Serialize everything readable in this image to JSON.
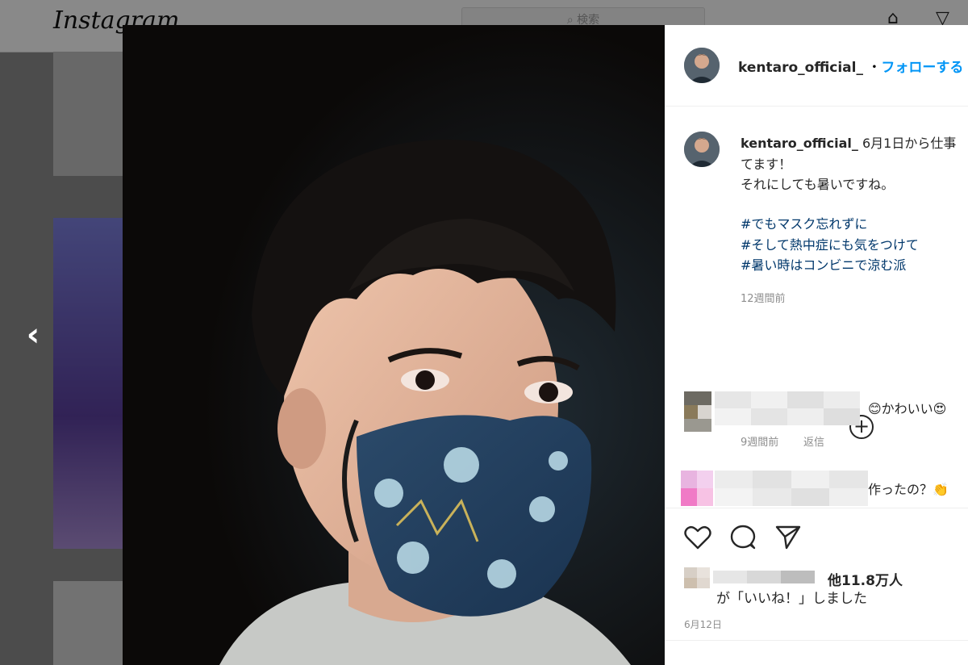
{
  "background": {
    "logo": "Instagram",
    "search_placeholder": "検索"
  },
  "modal": {
    "header": {
      "username": "kentaro_official_",
      "separator": "・",
      "follow_label": "フォローする"
    },
    "caption": {
      "username": "kentaro_official_",
      "text": "6月1日から仕事\nてます！\nそれにしても暑いですね。",
      "hashtags": [
        "#でもマスク忘れずに",
        "#そして熱中症にも気をつけて",
        "#暑い時はコンビニで涼む派"
      ],
      "time": "12週間前"
    },
    "comments": [
      {
        "text": "😊かわいい😍",
        "time": "9週間前",
        "reply_label": "返信"
      },
      {
        "text": "作ったの？👏"
      }
    ],
    "likes": {
      "count_label": "他11.8万人",
      "text": "が「いいね！」しました"
    },
    "date": "6月12日"
  }
}
